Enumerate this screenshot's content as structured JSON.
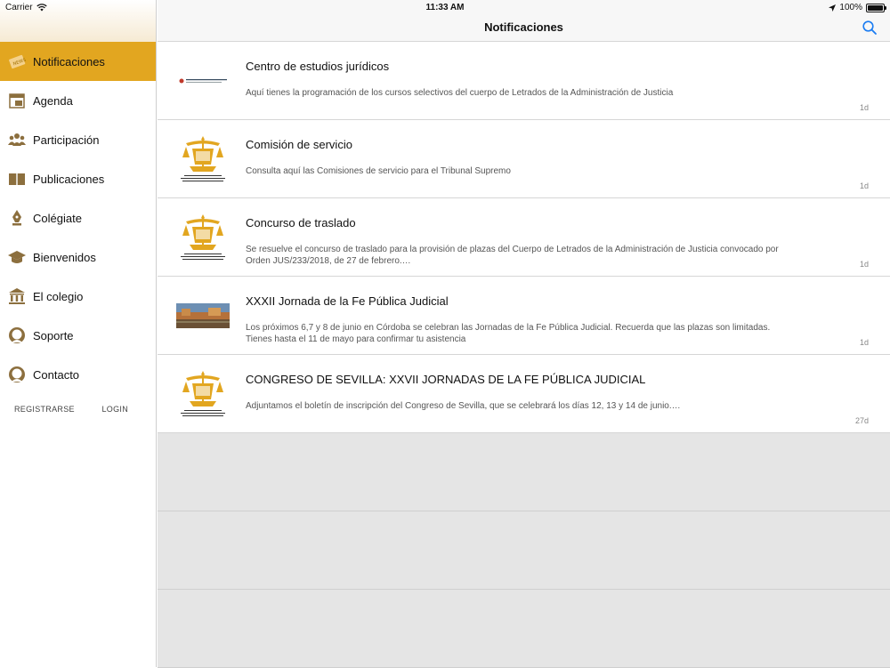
{
  "status_bar": {
    "carrier": "Carrier",
    "time": "11:33 AM",
    "battery": "100%"
  },
  "sidebar": {
    "items": [
      {
        "label": "Notificaciones",
        "icon": "news-icon",
        "active": true
      },
      {
        "label": "Agenda",
        "icon": "calendar-icon",
        "active": false
      },
      {
        "label": "Participación",
        "icon": "people-icon",
        "active": false
      },
      {
        "label": "Publicaciones",
        "icon": "book-icon",
        "active": false
      },
      {
        "label": "Colégiate",
        "icon": "pen-nib-icon",
        "active": false
      },
      {
        "label": "Bienvenidos",
        "icon": "graduation-cap-icon",
        "active": false
      },
      {
        "label": "El colegio",
        "icon": "institution-icon",
        "active": false
      },
      {
        "label": "Soporte",
        "icon": "support-agent-icon",
        "active": false
      },
      {
        "label": "Contacto",
        "icon": "contact-agent-icon",
        "active": false
      }
    ],
    "register_label": "REGISTRARSE",
    "login_label": "LOGIN"
  },
  "navbar": {
    "title": "Notificaciones"
  },
  "notifications": [
    {
      "title": "Centro de estudios jurídicos",
      "body": "Aquí tienes la programación de los cursos selectivos del cuerpo de Letrados de la Administración de Justicia",
      "time": "1d",
      "thumb": "banner"
    },
    {
      "title": "Comisión de servicio",
      "body": "Consulta aquí las Comisiones de servicio para el Tribunal Supremo",
      "time": "1d",
      "thumb": "crest"
    },
    {
      "title": "Concurso de traslado",
      "body": "Se resuelve el concurso de traslado para la provisión de plazas del Cuerpo de Letrados de la Administración de Justicia convocado por Orden JUS/233/2018, de 27 de febrero.…",
      "time": "1d",
      "thumb": "crest"
    },
    {
      "title": "XXXII Jornada de la Fe Pública Judicial",
      "body": "Los próximos 6,7 y 8 de junio en Córdoba se celebran las Jornadas de la Fe Pública Judicial. Recuerda que las plazas son limitadas. Tienes hasta el 11 de mayo para confirmar tu asistencia",
      "time": "1d",
      "thumb": "photo"
    },
    {
      "title": "CONGRESO DE SEVILLA: XXVII JORNADAS DE LA FE PÚBLICA JUDICIAL",
      "body": "Adjuntamos el boletín de inscripción del Congreso de Sevilla, que se celebrará los días 12, 13 y 14 de junio.…",
      "time": "27d",
      "thumb": "crest"
    }
  ],
  "colors": {
    "accent": "#e2a620",
    "search_tint": "#1a7cf2"
  }
}
